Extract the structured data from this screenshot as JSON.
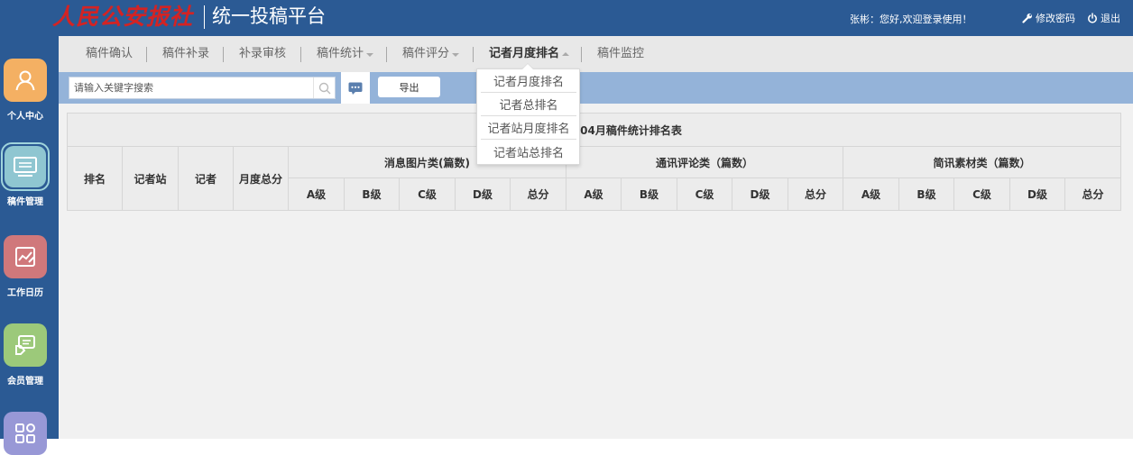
{
  "header": {
    "logo_calligraphy": "人民公安报社",
    "platform_title": "统一投稿平台",
    "greeting": "张彬：您好,欢迎登录使用！",
    "change_password": "修改密码",
    "logout": "退出",
    "colors": {
      "bar": "#2b5a94",
      "logo_red": "#d42323"
    }
  },
  "sidebar": {
    "items": [
      {
        "label": "个人中心",
        "icon": "user-icon",
        "color": "#f4b063"
      },
      {
        "label": "稿件管理",
        "icon": "monitor-icon",
        "color": "#8fc6d1",
        "active": true
      },
      {
        "label": "工作日历",
        "icon": "calendar-chart-icon",
        "color": "#d0787b"
      },
      {
        "label": "会员管理",
        "icon": "member-card-icon",
        "color": "#9cc97a"
      },
      {
        "label": "",
        "icon": "grid-apps-icon",
        "color": "#9898d6"
      }
    ]
  },
  "tabs": [
    {
      "label": "稿件确认"
    },
    {
      "label": "稿件补录"
    },
    {
      "label": "补录审核"
    },
    {
      "label": "稿件统计"
    },
    {
      "label": "稿件评分"
    },
    {
      "label": "记者月度排名"
    },
    {
      "label": "稿件监控"
    }
  ],
  "toolbar": {
    "search_placeholder": "请输入关键字搜索",
    "export_label": "导出"
  },
  "dropdown": {
    "items": [
      "记者月度排名",
      "记者总排名",
      "记者站月度排名",
      "记者站总排名"
    ]
  },
  "table": {
    "title_visible": "年04月稿件统计排名表",
    "fixed_headers": [
      "排名",
      "记者站",
      "记者",
      "月度总分"
    ],
    "groups": [
      "消息图片类(篇数)",
      "通讯评论类（篇数）",
      "简讯素材类（篇数）"
    ],
    "sub_headers": [
      "A级",
      "B级",
      "C级",
      "D级",
      "总分"
    ]
  }
}
